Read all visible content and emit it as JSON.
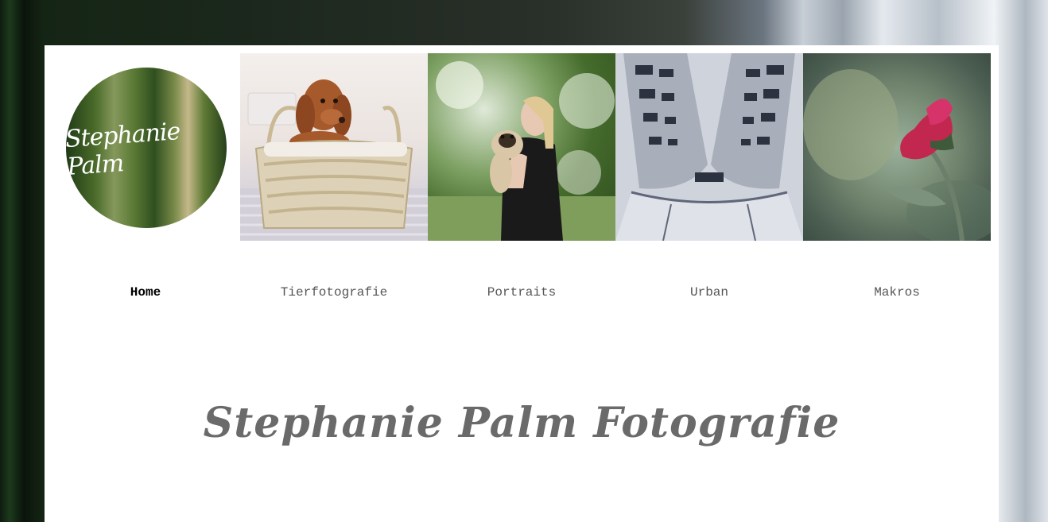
{
  "brand": {
    "logo_text": "Stephanie Palm"
  },
  "gallery": [
    {
      "subject": "dachshund puppy in wicker basket"
    },
    {
      "subject": "woman holding pug among blossoms"
    },
    {
      "subject": "curved urban building facade"
    },
    {
      "subject": "pink flower macro"
    }
  ],
  "nav": {
    "items": [
      {
        "label": "Home",
        "active": true
      },
      {
        "label": "Tierfotografie",
        "active": false
      },
      {
        "label": "Portraits",
        "active": false
      },
      {
        "label": "Urban",
        "active": false
      },
      {
        "label": "Makros",
        "active": false
      }
    ]
  },
  "site_title": "Stephanie Palm Fotografie",
  "colors": {
    "nav_active": "#000000",
    "nav_text": "#555555",
    "title": "#6a6a6a",
    "page_bg": "#ffffff"
  }
}
